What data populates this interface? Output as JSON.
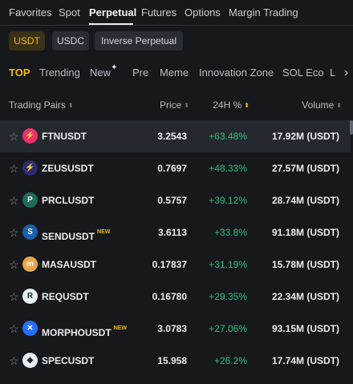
{
  "market_tabs": [
    {
      "label": "Favorites"
    },
    {
      "label": "Spot"
    },
    {
      "label": "Perpetual"
    },
    {
      "label": "Futures"
    },
    {
      "label": "Options"
    },
    {
      "label": "Margin Trading"
    }
  ],
  "active_market_tab": "Perpetual",
  "quote_chips": [
    {
      "label": "USDT"
    },
    {
      "label": "USDC"
    },
    {
      "label": "Inverse Perpetual"
    }
  ],
  "active_quote_chip": "USDT",
  "filters": [
    {
      "label": "TOP"
    },
    {
      "label": "Trending"
    },
    {
      "label": "New"
    },
    {
      "label": "Pre"
    },
    {
      "label": "Meme"
    },
    {
      "label": "Innovation Zone"
    },
    {
      "label": "SOL Eco"
    },
    {
      "label": "L"
    }
  ],
  "active_filter": "TOP",
  "table": {
    "headers": {
      "pair": "Trading Pairs",
      "price": "Price",
      "change": "24H %",
      "volume": "Volume"
    },
    "sorted_by": "24H %",
    "rows": [
      {
        "symbol": "FTNUSDT",
        "is_new": false,
        "new_badge": "",
        "price": "3.2543",
        "change": "+63.48%",
        "volume": "17.92M (USDT)",
        "icon": "ftn-coin-icon",
        "icon_glyph": "⚡",
        "icon_color": "#e8326f",
        "selected": true
      },
      {
        "symbol": "ZEUSUSDT",
        "is_new": false,
        "new_badge": "",
        "price": "0.7697",
        "change": "+48.33%",
        "volume": "27.57M (USDT)",
        "icon": "zeus-coin-icon",
        "icon_glyph": "⚡",
        "icon_color": "#2a2d6e",
        "selected": false
      },
      {
        "symbol": "PRCLUSDT",
        "is_new": false,
        "new_badge": "",
        "price": "0.5757",
        "change": "+39.12%",
        "volume": "28.74M (USDT)",
        "icon": "prcl-coin-icon",
        "icon_glyph": "P",
        "icon_color": "#1f6b5a",
        "selected": false
      },
      {
        "symbol": "SENDUSDT",
        "is_new": true,
        "new_badge": "NEW",
        "price": "3.6113",
        "change": "+33.8%",
        "volume": "91.18M (USDT)",
        "icon": "send-coin-icon",
        "icon_glyph": "S",
        "icon_color": "#1b5fa8",
        "selected": false
      },
      {
        "symbol": "MASAUSDT",
        "is_new": false,
        "new_badge": "",
        "price": "0.17837",
        "change": "+31.19%",
        "volume": "15.78M (USDT)",
        "icon": "masa-coin-icon",
        "icon_glyph": "m",
        "icon_color": "#e7a64a",
        "selected": false
      },
      {
        "symbol": "REQUSDT",
        "is_new": false,
        "new_badge": "",
        "price": "0.16780",
        "change": "+29.35%",
        "volume": "22.34M (USDT)",
        "icon": "req-coin-icon",
        "icon_glyph": "R",
        "icon_color": "#e9f3ef",
        "selected": false
      },
      {
        "symbol": "MORPHOUSDT",
        "is_new": true,
        "new_badge": "NEW",
        "price": "3.0783",
        "change": "+27.06%",
        "volume": "93.15M (USDT)",
        "icon": "morpho-coin-icon",
        "icon_glyph": "✕",
        "icon_color": "#2470ff",
        "selected": false
      },
      {
        "symbol": "SPECUSDT",
        "is_new": false,
        "new_badge": "",
        "price": "15.958",
        "change": "+26.2%",
        "volume": "17.74M (USDT)",
        "icon": "spec-coin-icon",
        "icon_glyph": "◆",
        "icon_color": "#e9eef6",
        "selected": false
      }
    ]
  },
  "colors": {
    "background": "#16181c",
    "accent": "#f0b90b",
    "positive": "#2ebd85",
    "selected_row": "#25282e"
  }
}
